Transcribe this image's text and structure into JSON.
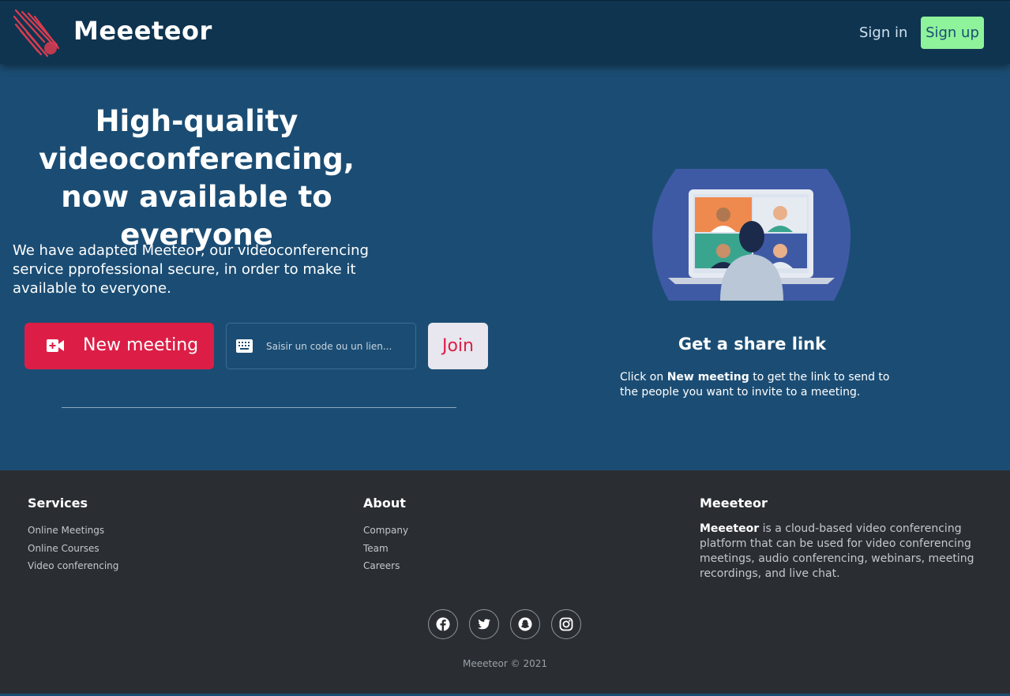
{
  "header": {
    "brand": "Meeeteor",
    "sign_in": "Sign in",
    "sign_up": "Sign up"
  },
  "hero": {
    "title": "High-quality videoconferencing, now available to everyone",
    "description": "We have adapted Meeteor, our videoconferencing service pprofessional secure, in order to make it available to everyone.",
    "new_meeting": "New meeting",
    "code_placeholder": "Saisir un code ou un lien...",
    "join": "Join"
  },
  "share": {
    "title": "Get a share link",
    "text_prefix": "Click on",
    "text_bold": "New meeting",
    "text_suffix": "to get the link to send to the people you want to invite to a meeting."
  },
  "footer": {
    "services": {
      "title": "Services",
      "links": [
        "Online Meetings",
        "Online Courses",
        "Video conferencing"
      ]
    },
    "about": {
      "title": "About",
      "links": [
        "Company",
        "Team",
        "Careers"
      ]
    },
    "brand_col": {
      "title": "Meeeteor",
      "bold": "Meeeteor",
      "text": "is a cloud-based video conferencing platform that can be used for video conferencing meetings, audio conferencing, webinars, meeting recordings, and live chat."
    },
    "socials": [
      "facebook-icon",
      "twitter-icon",
      "snapchat-icon",
      "instagram-icon"
    ],
    "copyright": "Meeeteor © 2021"
  },
  "colors": {
    "page_bg": "#1b4d74",
    "topbar_bg": "#0f3450",
    "accent_red": "#dc1e46",
    "signup_green": "#8ef39a",
    "footer_bg": "#2a2e33"
  }
}
